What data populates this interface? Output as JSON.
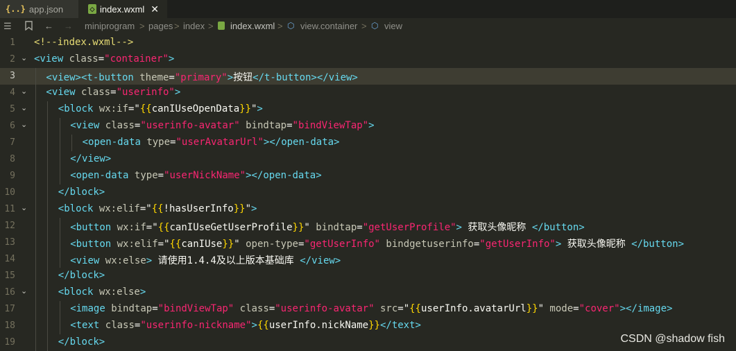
{
  "tabs": [
    {
      "icon": "{..}",
      "label": "app.json",
      "active": false
    },
    {
      "icon": "◇",
      "label": "index.wxml",
      "active": true,
      "close": "✕"
    }
  ],
  "breadcrumb": {
    "items": [
      "miniprogram",
      "pages",
      "index",
      "index.wxml",
      "view.container",
      "view"
    ],
    "separator": ">"
  },
  "colors": {
    "background": "#272822",
    "tag": "#66d9ef",
    "attribute": "#c8c8b6",
    "string": "#f92672",
    "comment": "#e6db74",
    "bracket": "#ffd700"
  },
  "current_line": 3,
  "lines": [
    {
      "n": "1",
      "fold": "",
      "indent": 0,
      "tokens": [
        [
          "cmt",
          "<!--index.wxml-->"
        ]
      ]
    },
    {
      "n": "2",
      "fold": "⌄",
      "indent": 0,
      "tokens": [
        [
          "tag",
          "<view "
        ],
        [
          "attr",
          "class"
        ],
        [
          "pun",
          "="
        ],
        [
          "str",
          "\"container\""
        ],
        [
          "tag",
          ">"
        ]
      ]
    },
    {
      "n": "3",
      "fold": "",
      "indent": 1,
      "tokens": [
        [
          "tag",
          "<view><t-button "
        ],
        [
          "attr",
          "theme"
        ],
        [
          "pun",
          "="
        ],
        [
          "str",
          "\"primary\""
        ],
        [
          "tag",
          ">"
        ],
        [
          "txt",
          "按钮"
        ],
        [
          "tag",
          "</t-button></view>"
        ]
      ]
    },
    {
      "n": "4",
      "fold": "⌄",
      "indent": 1,
      "tokens": [
        [
          "tag",
          "<view "
        ],
        [
          "attr",
          "class"
        ],
        [
          "pun",
          "="
        ],
        [
          "str",
          "\"userinfo\""
        ],
        [
          "tag",
          ">"
        ]
      ]
    },
    {
      "n": "5",
      "fold": "⌄",
      "indent": 2,
      "tokens": [
        [
          "tag",
          "<block "
        ],
        [
          "attr",
          "wx:if"
        ],
        [
          "pun",
          "=\""
        ],
        [
          "br",
          "{{"
        ],
        [
          "var",
          "canIUseOpenData"
        ],
        [
          "br",
          "}}"
        ],
        [
          "pun",
          "\""
        ],
        [
          "tag",
          ">"
        ]
      ]
    },
    {
      "n": "6",
      "fold": "⌄",
      "indent": 3,
      "tokens": [
        [
          "tag",
          "<view "
        ],
        [
          "attr",
          "class"
        ],
        [
          "pun",
          "="
        ],
        [
          "str",
          "\"userinfo-avatar\""
        ],
        [
          "attr",
          " bindtap"
        ],
        [
          "pun",
          "="
        ],
        [
          "str",
          "\"bindViewTap\""
        ],
        [
          "tag",
          ">"
        ]
      ]
    },
    {
      "n": "7",
      "fold": "",
      "indent": 4,
      "tokens": [
        [
          "tag",
          "<open-data "
        ],
        [
          "attr",
          "type"
        ],
        [
          "pun",
          "="
        ],
        [
          "str",
          "\"userAvatarUrl\""
        ],
        [
          "tag",
          "></open-data>"
        ]
      ]
    },
    {
      "n": "8",
      "fold": "",
      "indent": 3,
      "tokens": [
        [
          "tag",
          "</view>"
        ]
      ]
    },
    {
      "n": "9",
      "fold": "",
      "indent": 3,
      "tokens": [
        [
          "tag",
          "<open-data "
        ],
        [
          "attr",
          "type"
        ],
        [
          "pun",
          "="
        ],
        [
          "str",
          "\"userNickName\""
        ],
        [
          "tag",
          "></open-data>"
        ]
      ]
    },
    {
      "n": "10",
      "fold": "",
      "indent": 2,
      "tokens": [
        [
          "tag",
          "</block>"
        ]
      ]
    },
    {
      "n": "11",
      "fold": "⌄",
      "indent": 2,
      "tokens": [
        [
          "tag",
          "<block "
        ],
        [
          "attr",
          "wx:elif"
        ],
        [
          "pun",
          "=\""
        ],
        [
          "br",
          "{{"
        ],
        [
          "var",
          "!hasUserInfo"
        ],
        [
          "br",
          "}}"
        ],
        [
          "pun",
          "\""
        ],
        [
          "tag",
          ">"
        ]
      ]
    },
    {
      "n": "12",
      "fold": "",
      "indent": 3,
      "tokens": [
        [
          "tag",
          "<button "
        ],
        [
          "attr",
          "wx:if"
        ],
        [
          "pun",
          "=\""
        ],
        [
          "br",
          "{{"
        ],
        [
          "var",
          "canIUseGetUserProfile"
        ],
        [
          "br",
          "}}"
        ],
        [
          "pun",
          "\""
        ],
        [
          "attr",
          " bindtap"
        ],
        [
          "pun",
          "="
        ],
        [
          "str",
          "\"getUserProfile\""
        ],
        [
          "tag",
          "> "
        ],
        [
          "txt",
          "获取头像昵称"
        ],
        [
          "tag",
          " </button>"
        ]
      ]
    },
    {
      "n": "13",
      "fold": "",
      "indent": 3,
      "tokens": [
        [
          "tag",
          "<button "
        ],
        [
          "attr",
          "wx:elif"
        ],
        [
          "pun",
          "=\""
        ],
        [
          "br",
          "{{"
        ],
        [
          "var",
          "canIUse"
        ],
        [
          "br",
          "}}"
        ],
        [
          "pun",
          "\""
        ],
        [
          "attr",
          " open-type"
        ],
        [
          "pun",
          "="
        ],
        [
          "str",
          "\"getUserInfo\""
        ],
        [
          "attr",
          " bindgetuserinfo"
        ],
        [
          "pun",
          "="
        ],
        [
          "str",
          "\"getUserInfo\""
        ],
        [
          "tag",
          "> "
        ],
        [
          "txt",
          "获取头像昵称"
        ],
        [
          "tag",
          " </button>"
        ]
      ]
    },
    {
      "n": "14",
      "fold": "",
      "indent": 3,
      "tokens": [
        [
          "tag",
          "<view "
        ],
        [
          "attr",
          "wx:else"
        ],
        [
          "tag",
          "> "
        ],
        [
          "txt",
          "请使用1.4.4及以上版本基础库"
        ],
        [
          "tag",
          " </view>"
        ]
      ]
    },
    {
      "n": "15",
      "fold": "",
      "indent": 2,
      "tokens": [
        [
          "tag",
          "</block>"
        ]
      ]
    },
    {
      "n": "16",
      "fold": "⌄",
      "indent": 2,
      "tokens": [
        [
          "tag",
          "<block "
        ],
        [
          "attr",
          "wx:else"
        ],
        [
          "tag",
          ">"
        ]
      ]
    },
    {
      "n": "17",
      "fold": "",
      "indent": 3,
      "tokens": [
        [
          "tag",
          "<image "
        ],
        [
          "attr",
          "bindtap"
        ],
        [
          "pun",
          "="
        ],
        [
          "str",
          "\"bindViewTap\""
        ],
        [
          "attr",
          " class"
        ],
        [
          "pun",
          "="
        ],
        [
          "str",
          "\"userinfo-avatar\""
        ],
        [
          "attr",
          " src"
        ],
        [
          "pun",
          "=\""
        ],
        [
          "br",
          "{{"
        ],
        [
          "var",
          "userInfo.avatarUrl"
        ],
        [
          "br",
          "}}"
        ],
        [
          "pun",
          "\""
        ],
        [
          "attr",
          " mode"
        ],
        [
          "pun",
          "="
        ],
        [
          "str",
          "\"cover\""
        ],
        [
          "tag",
          "></image>"
        ]
      ]
    },
    {
      "n": "18",
      "fold": "",
      "indent": 3,
      "tokens": [
        [
          "tag",
          "<text "
        ],
        [
          "attr",
          "class"
        ],
        [
          "pun",
          "="
        ],
        [
          "str",
          "\"userinfo-nickname\""
        ],
        [
          "tag",
          ">"
        ],
        [
          "br",
          "{{"
        ],
        [
          "var",
          "userInfo.nickName"
        ],
        [
          "br",
          "}}"
        ],
        [
          "tag",
          "</text>"
        ]
      ]
    },
    {
      "n": "19",
      "fold": "",
      "indent": 2,
      "tokens": [
        [
          "tag",
          "</block>"
        ]
      ]
    }
  ],
  "watermark": "CSDN @shadow fish"
}
